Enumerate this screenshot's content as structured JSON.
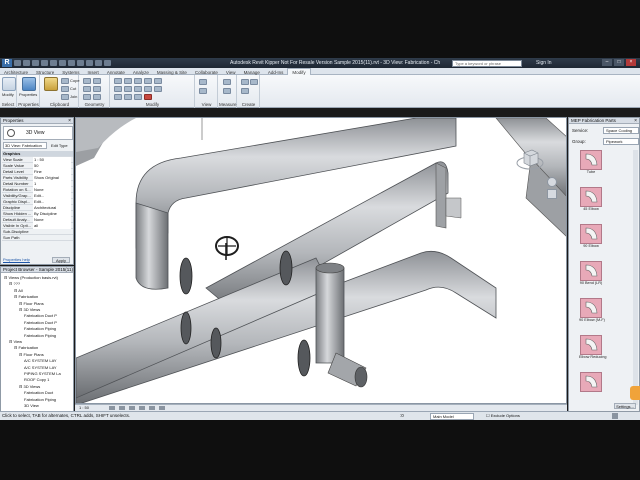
{
  "window": {
    "title": "Autodesk Revit Kipper   Not For Resale Version   Sample 2015(11).rvt - 3D View: Fabrication - Chiller View Supply",
    "search_placeholder": "Type a keyword or phrase",
    "sign_in": "Sign In",
    "app_logo": "R"
  },
  "ribbon": {
    "tabs": [
      "Architecture",
      "Structure",
      "Systems",
      "Insert",
      "Annotate",
      "Analyze",
      "Massing & Site",
      "Collaborate",
      "View",
      "Manage",
      "Add-Ins",
      "Modify"
    ],
    "active_tab": "Modify",
    "panels": [
      {
        "label": "Select",
        "buttons": [
          "Modify"
        ]
      },
      {
        "label": "Properties",
        "buttons": [
          "Properties"
        ]
      },
      {
        "label": "Clipboard",
        "buttons": [
          "Paste",
          "Cope",
          "Cut",
          "Join"
        ]
      },
      {
        "label": "Geometry",
        "buttons": []
      },
      {
        "label": "Modify",
        "buttons": []
      },
      {
        "label": "View",
        "buttons": []
      },
      {
        "label": "Measure",
        "buttons": []
      },
      {
        "label": "Create",
        "buttons": []
      }
    ]
  },
  "properties": {
    "header": "Properties",
    "type_name": "3D View",
    "view_combo": "3D View: Fabrication",
    "edit_type": "Edit Type",
    "rows": [
      {
        "name": "Graphics",
        "value": "",
        "group": true
      },
      {
        "name": "View Scale",
        "value": "1 : 50",
        "group": false
      },
      {
        "name": "Scale Value",
        "value": "50",
        "group": false
      },
      {
        "name": "Detail Level",
        "value": "Fine",
        "group": false
      },
      {
        "name": "Parts Visibility",
        "value": "Show Original",
        "group": false
      },
      {
        "name": "Detail Number",
        "value": "1",
        "group": false
      },
      {
        "name": "Rotation on S...",
        "value": "None",
        "group": false
      },
      {
        "name": "Visibility/Grap...",
        "value": "Edit...",
        "group": false
      },
      {
        "name": "Graphic Displ...",
        "value": "Edit...",
        "group": false
      },
      {
        "name": "Discipline",
        "value": "Architectural",
        "group": false
      },
      {
        "name": "Show Hidden ...",
        "value": "By Discipline",
        "group": false
      },
      {
        "name": "Default Analy...",
        "value": "None",
        "group": false
      },
      {
        "name": "Visible In Opti...",
        "value": "all",
        "group": false
      },
      {
        "name": "Sub-Discipline",
        "value": "",
        "group": false
      },
      {
        "name": "Sun Path",
        "value": "",
        "group": false
      }
    ],
    "help_link": "Properties help",
    "apply": "Apply"
  },
  "project_browser": {
    "header": "Project Browser - Sample 2015(11).rvt",
    "items": [
      {
        "label": "Views (Production basis.rvt)",
        "indent": 0
      },
      {
        "label": "???",
        "indent": 1
      },
      {
        "label": "All",
        "indent": 2
      },
      {
        "label": "Fabrication",
        "indent": 2
      },
      {
        "label": "Floor Plans",
        "indent": 3
      },
      {
        "label": "3D Views",
        "indent": 3
      },
      {
        "label": "Fabrication Duct P",
        "indent": 4
      },
      {
        "label": "Fabrication Duct P",
        "indent": 4
      },
      {
        "label": "Fabrication Piping",
        "indent": 4
      },
      {
        "label": "Fabrication Piping",
        "indent": 4
      },
      {
        "label": "View",
        "indent": 1
      },
      {
        "label": "Fabrication",
        "indent": 2
      },
      {
        "label": "Floor Plans",
        "indent": 3
      },
      {
        "label": "A/C SYSTEM LAY",
        "indent": 4
      },
      {
        "label": "A/C SYSTEM LAY",
        "indent": 4
      },
      {
        "label": "PIPING SYSTEM La",
        "indent": 4
      },
      {
        "label": "ROOF Copy 1",
        "indent": 4
      },
      {
        "label": "3D Views",
        "indent": 3
      },
      {
        "label": "Fabrication Duct",
        "indent": 4
      },
      {
        "label": "Fabrication Piping",
        "indent": 4
      },
      {
        "label": "3D View",
        "indent": 4
      }
    ]
  },
  "view_control": {
    "scale": "1 : 50"
  },
  "status": {
    "message": "Click to select, TAB for alternates, CTRL adds, SHIFT unselects.",
    "model": "Main Model",
    "exclusive": "Exclude Options",
    "worksets_value": ":0"
  },
  "mep_parts": {
    "header": "MEP Fabrication Parts",
    "service_label": "Service:",
    "service_value": "Space Cooling",
    "group_label": "Group:",
    "group_value": "Pipework",
    "parts": [
      "Tube",
      "45 Elbow",
      "90 Elbow",
      "90 Bend (LR)",
      "90 Elbow (M-F)",
      "Elbow Reducing",
      ""
    ],
    "settings": "Settings..."
  },
  "colors": {
    "ribbon_bg": "#eef2f6",
    "title_bar": "#2a3543",
    "part_thumb": "#e8a9b8",
    "pipe": "#b9bcc0"
  },
  "icons": [
    "gear-icon",
    "magnifier-icon",
    "close-icon",
    "minimize-icon",
    "maximize-icon",
    "viewcube-icon",
    "valve-handwheel-icon"
  ]
}
